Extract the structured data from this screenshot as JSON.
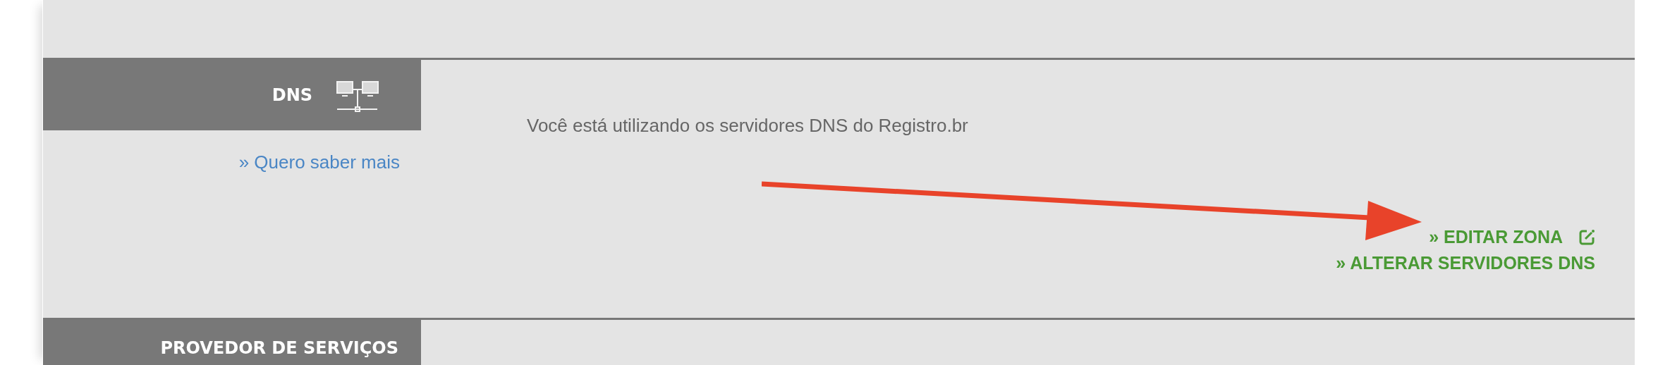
{
  "sections": [
    {
      "title": "DNS",
      "link": "» Quero saber mais",
      "message": "Você está utilizando os servidores DNS do Registro.br",
      "actions": [
        {
          "label": "» EDITAR ZONA"
        },
        {
          "label": "» ALTERAR SERVIDORES DNS"
        }
      ],
      "annotations": [
        {
          "kind": "arrow"
        }
      ]
    },
    {
      "title": "PROVEDOR DE SERVIÇOS"
    }
  ]
}
